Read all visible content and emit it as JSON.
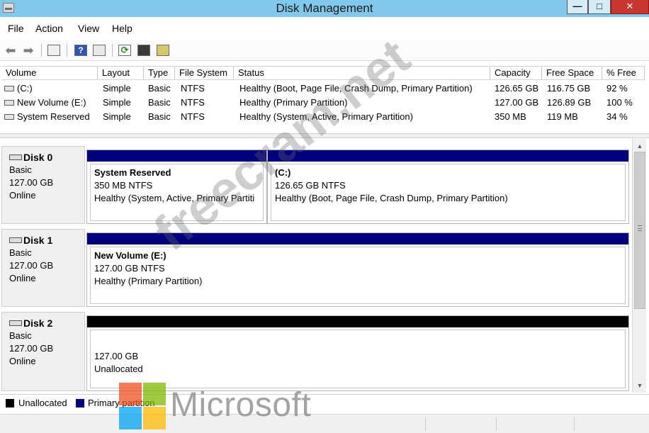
{
  "window": {
    "title": "Disk Management",
    "buttons": {
      "minimize": "—",
      "maximize": "□",
      "close": "✕"
    }
  },
  "menu": [
    "File",
    "Action",
    "View",
    "Help"
  ],
  "toolbar": {
    "icons": [
      "back-arrow-icon",
      "forward-arrow-icon",
      "console-tree-icon",
      "help-icon",
      "action-pane-icon",
      "refresh-icon",
      "properties-icon",
      "rescan-disks-icon"
    ],
    "glyphs": {
      "back": "⬅",
      "forward": "➡",
      "help": "?",
      "refresh": "⟳"
    }
  },
  "volume_list": {
    "columns": [
      "Volume",
      "Layout",
      "Type",
      "File System",
      "Status",
      "Capacity",
      "Free Space",
      "% Free"
    ],
    "rows": [
      [
        "(C:)",
        "Simple",
        "Basic",
        "NTFS",
        "Healthy (Boot, Page File, Crash Dump, Primary Partition)",
        "126.65 GB",
        "116.75 GB",
        "92 %"
      ],
      [
        "New Volume (E:)",
        "Simple",
        "Basic",
        "NTFS",
        "Healthy (Primary Partition)",
        "127.00 GB",
        "126.89 GB",
        "100 %"
      ],
      [
        "System Reserved",
        "Simple",
        "Basic",
        "NTFS",
        "Healthy (System, Active, Primary Partition)",
        "350 MB",
        "119 MB",
        "34 %"
      ]
    ]
  },
  "disks": [
    {
      "name": "Disk 0",
      "type": "Basic",
      "size": "127.00 GB",
      "state": "Online",
      "partitions": [
        {
          "name": "System Reserved",
          "size": "350 MB NTFS",
          "status": "Healthy (System, Active, Primary Partiti",
          "kind": "primary"
        },
        {
          "name": "(C:)",
          "size": "126.65 GB NTFS",
          "status": "Healthy (Boot, Page File, Crash Dump, Primary Partition)",
          "kind": "primary"
        }
      ]
    },
    {
      "name": "Disk 1",
      "type": "Basic",
      "size": "127.00 GB",
      "state": "Online",
      "partitions": [
        {
          "name": "New Volume  (E:)",
          "size": "127.00 GB NTFS",
          "status": "Healthy (Primary Partition)",
          "kind": "primary"
        }
      ]
    },
    {
      "name": "Disk 2",
      "type": "Basic",
      "size": "127.00 GB",
      "state": "Online",
      "partitions": [
        {
          "name": "",
          "size": "127.00 GB",
          "status": "Unallocated",
          "kind": "unallocated"
        }
      ]
    }
  ],
  "legend": [
    {
      "label": "Unallocated",
      "color": "#000000"
    },
    {
      "label": "Primary partition",
      "color": "#00007f"
    }
  ],
  "colors": {
    "title_bar": "#80c8ec",
    "primary_partition": "#00007f",
    "unallocated": "#000000",
    "close_button": "#c7372f"
  },
  "overlay": {
    "watermark": "freecram.net",
    "logo_text": "Microsoft",
    "logo_colors": [
      "#f25022",
      "#7fba00",
      "#00a4ef",
      "#ffb900"
    ]
  },
  "scrollbar": {
    "up": "▲",
    "down": "▼"
  }
}
